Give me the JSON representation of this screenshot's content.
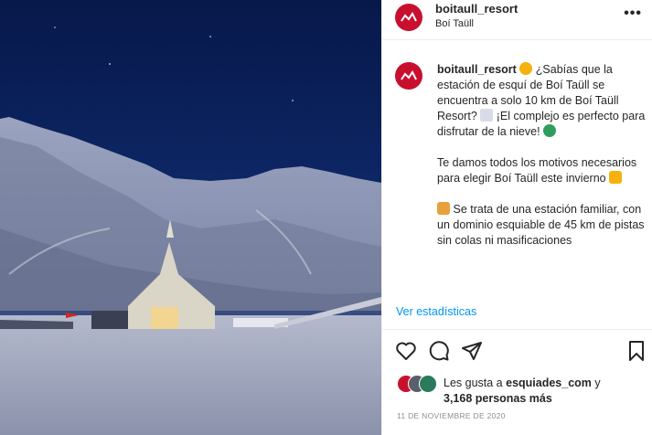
{
  "post": {
    "username": "boitaull_resort",
    "location": "Boí Taüll",
    "more_label": "•••"
  },
  "caption": {
    "username": "boitaull_resort",
    "p1": "¿Sabías que la estación de esquí de Boí Taüll se encuentra a solo 10 km de Boí Taüll Resort?",
    "p1b": "¡El complejo es perfecto para disfrutar de la nieve!",
    "p2": "Te damos todos los motivos necesarios para elegir Boí Taüll este invierno",
    "p3": "Se trata de una estación familiar, con un dominio esquiable de 45 km de pistas sin colas ni masificaciones"
  },
  "stats_link": "Ver estadísticas",
  "likes": {
    "prefix": "Les gusta a",
    "user": "esquiades_com",
    "suffix": " y",
    "count": "3,168 personas más"
  },
  "date": "11 DE NOVIEMBRE DE 2020",
  "icons": {
    "like": "heart-icon",
    "comment": "comment-icon",
    "share": "share-icon",
    "save": "bookmark-icon",
    "more": "more-icon"
  },
  "colors": {
    "brand": "#c8102e",
    "link": "#0095f6",
    "sky": "#0b1f55"
  }
}
